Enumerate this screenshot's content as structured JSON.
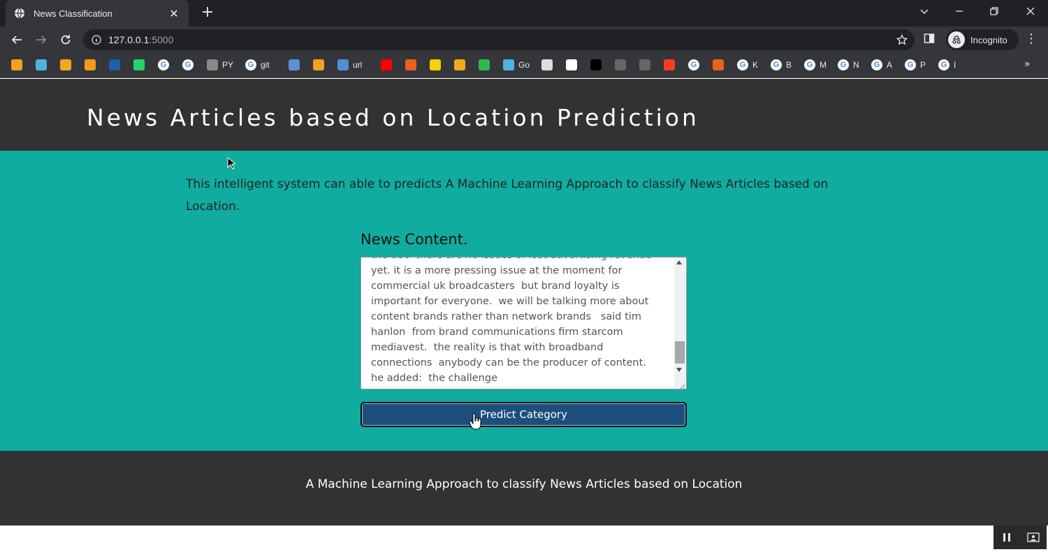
{
  "browser": {
    "tab_title": "News Classification",
    "url_host": "127.0.0.1",
    "url_port": ":5000",
    "profile_label": "Incognito",
    "bookmarks": [
      {
        "icon": "arrow-bookmark-icon",
        "label": "",
        "color": "#f4a020"
      },
      {
        "icon": "swirl-bookmark-icon",
        "label": "",
        "color": "#4fb3e0"
      },
      {
        "icon": "box-bookmark-icon",
        "label": "",
        "color": "#f2a81d"
      },
      {
        "icon": "bars-bookmark-icon",
        "label": "",
        "color": "#f29b1d"
      },
      {
        "icon": "ieee-bookmark-icon",
        "label": "",
        "color": "#1d5fa8"
      },
      {
        "icon": "whatsapp-bookmark-icon",
        "label": "",
        "color": "#25d366"
      },
      {
        "icon": "google-icon",
        "label": ""
      },
      {
        "icon": "google-icon",
        "label": ""
      },
      {
        "icon": "github-icon",
        "label": "PY"
      },
      {
        "icon": "google-icon",
        "label": "git"
      },
      {
        "icon": "car-bookmark-icon",
        "label": "",
        "color": "#5b8fd6"
      },
      {
        "icon": "pyramid-bookmark-icon",
        "label": "",
        "color": "#f4a020"
      },
      {
        "icon": "image-bookmark-icon",
        "label": "url",
        "color": "#4f8fd6"
      },
      {
        "icon": "youtube-icon",
        "label": "",
        "color": "#ff0000"
      },
      {
        "icon": "eye-bookmark-icon",
        "label": "",
        "color": "#e8621a"
      },
      {
        "icon": "p-bookmark-icon",
        "label": "",
        "color": "#f7d300"
      },
      {
        "icon": "camera-bookmark-icon",
        "label": "",
        "color": "#f2a81d"
      },
      {
        "icon": "circle-bookmark-icon",
        "label": "",
        "color": "#2fb84f"
      },
      {
        "icon": "swirl-bookmark-icon",
        "label": "Go",
        "color": "#4fb3e0"
      },
      {
        "icon": "doc-bookmark-icon",
        "label": "",
        "color": "#dddddd"
      },
      {
        "icon": "doc-bookmark-icon",
        "label": "",
        "color": "#ffffff"
      },
      {
        "icon": "cl-bookmark-icon",
        "label": "",
        "color": "#000000"
      },
      {
        "icon": "globe-icon",
        "label": "",
        "color": "#666666"
      },
      {
        "icon": "globe-icon",
        "label": "",
        "color": "#666666"
      },
      {
        "icon": "yandex-icon",
        "label": "",
        "color": "#fc3f1d"
      },
      {
        "icon": "google-icon",
        "label": ""
      },
      {
        "icon": "bolt-bookmark-icon",
        "label": "",
        "color": "#e8621a"
      },
      {
        "icon": "google-icon",
        "label": "K"
      },
      {
        "icon": "google-icon",
        "label": "B"
      },
      {
        "icon": "google-icon",
        "label": "M"
      },
      {
        "icon": "google-icon",
        "label": "N"
      },
      {
        "icon": "google-icon",
        "label": "A"
      },
      {
        "icon": "google-icon",
        "label": "P"
      },
      {
        "icon": "google-icon",
        "label": "I"
      }
    ]
  },
  "page": {
    "title": "News Articles based on Location Prediction",
    "intro": "This intelligent system can able to predicts A Machine Learning Approach to classify News Articles based on Location.",
    "form_label": "News Content.",
    "textarea_value": "the bbc  there are no issues of lost advertising revenue yet. it is a more pressing issue at the moment for commercial uk broadcasters  but brand loyalty is important for everyone.  we will be talking more about content brands rather than network brands   said tim hanlon  from brand communications firm starcom mediavest.  the reality is that with broadband connections  anybody can be the producer of content.  he added:  the challenge",
    "button_label": "Predict Category",
    "footer_text": "A Machine Learning Approach to classify News Articles based on Location"
  },
  "colors": {
    "header_bg": "#323232",
    "main_bg": "#10aca0",
    "button_bg": "#1c4f7c"
  }
}
